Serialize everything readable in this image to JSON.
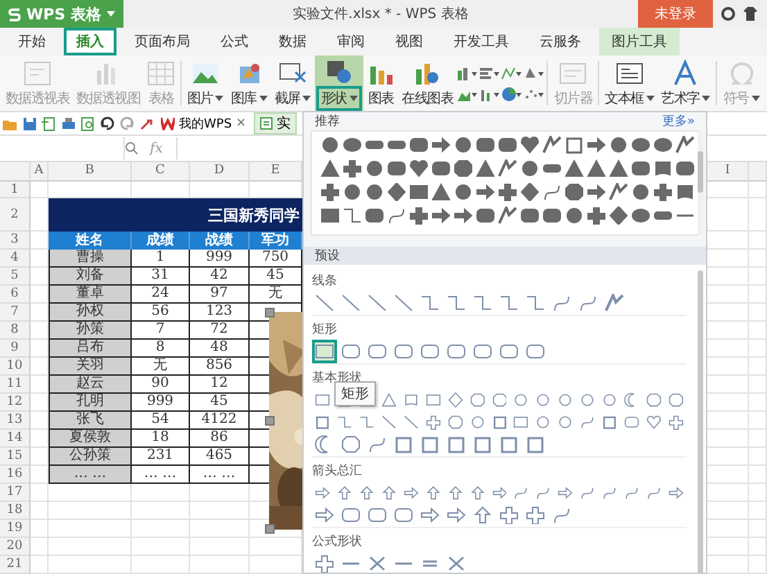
{
  "title_bar": {
    "app_name": "WPS 表格",
    "document_title": "实验文件.xlsx * - WPS 表格",
    "login_button": "未登录"
  },
  "tabs": [
    {
      "label": "开始",
      "selected": false,
      "kind": "normal"
    },
    {
      "label": "插入",
      "selected": true,
      "kind": "normal"
    },
    {
      "label": "页面布局",
      "selected": false,
      "kind": "normal"
    },
    {
      "label": "公式",
      "selected": false,
      "kind": "normal"
    },
    {
      "label": "数据",
      "selected": false,
      "kind": "normal"
    },
    {
      "label": "审阅",
      "selected": false,
      "kind": "normal"
    },
    {
      "label": "视图",
      "selected": false,
      "kind": "normal"
    },
    {
      "label": "开发工具",
      "selected": false,
      "kind": "normal"
    },
    {
      "label": "云服务",
      "selected": false,
      "kind": "normal"
    },
    {
      "label": "图片工具",
      "selected": false,
      "kind": "contextual"
    }
  ],
  "ribbon": {
    "items": [
      {
        "kind": "button",
        "label": "数据透视表",
        "disabled": true,
        "selected": false,
        "dropdown": false
      },
      {
        "kind": "button",
        "label": "数据透视图",
        "disabled": true,
        "selected": false,
        "dropdown": false
      },
      {
        "kind": "button",
        "label": "表格",
        "disabled": true,
        "selected": false,
        "dropdown": false
      },
      {
        "kind": "separator"
      },
      {
        "kind": "button",
        "label": "图片",
        "disabled": false,
        "selected": false,
        "dropdown": true
      },
      {
        "kind": "button",
        "label": "图库",
        "disabled": false,
        "selected": false,
        "dropdown": true
      },
      {
        "kind": "button",
        "label": "截屏",
        "disabled": false,
        "selected": false,
        "dropdown": true
      },
      {
        "kind": "button",
        "label": "形状",
        "disabled": false,
        "selected": true,
        "dropdown": true
      },
      {
        "kind": "button",
        "label": "图表",
        "disabled": false,
        "selected": false,
        "dropdown": false
      },
      {
        "kind": "button",
        "label": "在线图表",
        "disabled": false,
        "selected": false,
        "dropdown": false
      },
      {
        "kind": "chart_grid"
      },
      {
        "kind": "separator"
      },
      {
        "kind": "button",
        "label": "切片器",
        "disabled": true,
        "selected": false,
        "dropdown": false
      },
      {
        "kind": "separator"
      },
      {
        "kind": "button",
        "label": "文本框",
        "disabled": false,
        "selected": false,
        "dropdown": true
      },
      {
        "kind": "button",
        "label": "艺术字",
        "disabled": false,
        "selected": false,
        "dropdown": true
      },
      {
        "kind": "separator"
      },
      {
        "kind": "button",
        "label": "符号",
        "disabled": true,
        "selected": false,
        "dropdown": true
      }
    ]
  },
  "quick_bar": {
    "tabs": [
      {
        "label": "我的WPS",
        "close": "×"
      },
      {
        "label": "实"
      }
    ]
  },
  "formula_bar": {
    "function_label": "fx"
  },
  "sheet": {
    "column_headers": [
      "A",
      "B",
      "C",
      "D",
      "E"
    ],
    "column_header_far": "I",
    "row_numbers": [
      "1",
      "2",
      "3",
      "4",
      "5",
      "6",
      "7",
      "8",
      "9",
      "10",
      "11",
      "12",
      "13",
      "14",
      "15",
      "16",
      "17",
      "18",
      "19",
      "20",
      "21"
    ],
    "title": "三国新秀同学",
    "header": [
      "姓名",
      "成绩",
      "战绩",
      "军功"
    ],
    "rows": [
      [
        "曹操",
        "1",
        "999",
        "750"
      ],
      [
        "刘备",
        "31",
        "42",
        "45"
      ],
      [
        "董卓",
        "24",
        "97",
        "无"
      ],
      [
        "孙权",
        "56",
        "123"
      ],
      [
        "孙策",
        "7",
        "72"
      ],
      [
        "吕布",
        "8",
        "48"
      ],
      [
        "关羽",
        "无",
        "856"
      ],
      [
        "赵云",
        "90",
        "12"
      ],
      [
        "孔明",
        "999",
        "45"
      ],
      [
        "张飞",
        "54",
        "4122"
      ],
      [
        "夏侯敦",
        "18",
        "86"
      ],
      [
        "公孙策",
        "231",
        "465"
      ],
      [
        "… …",
        "… …",
        "… …"
      ]
    ],
    "picture": {
      "kind": "picture"
    }
  },
  "shapes_panel": {
    "recommended_title": "推荐",
    "more_link": "更多»",
    "presets_title": "预设",
    "categories": [
      {
        "title": "线条",
        "kind": "lines"
      },
      {
        "title": "矩形",
        "kind": "rectangles",
        "shapes": [
          {
            "selected": true
          },
          {
            "selected": false
          },
          {
            "selected": false
          },
          {
            "selected": false
          },
          {
            "selected": false
          },
          {
            "selected": false
          },
          {
            "selected": false
          },
          {
            "selected": false
          },
          {
            "selected": false
          }
        ]
      },
      {
        "title": "基本形状",
        "kind": "basic"
      },
      {
        "title": "箭头总汇",
        "kind": "arrows"
      },
      {
        "title": "公式形状",
        "kind": "equation"
      }
    ],
    "tooltip": "矩形"
  }
}
